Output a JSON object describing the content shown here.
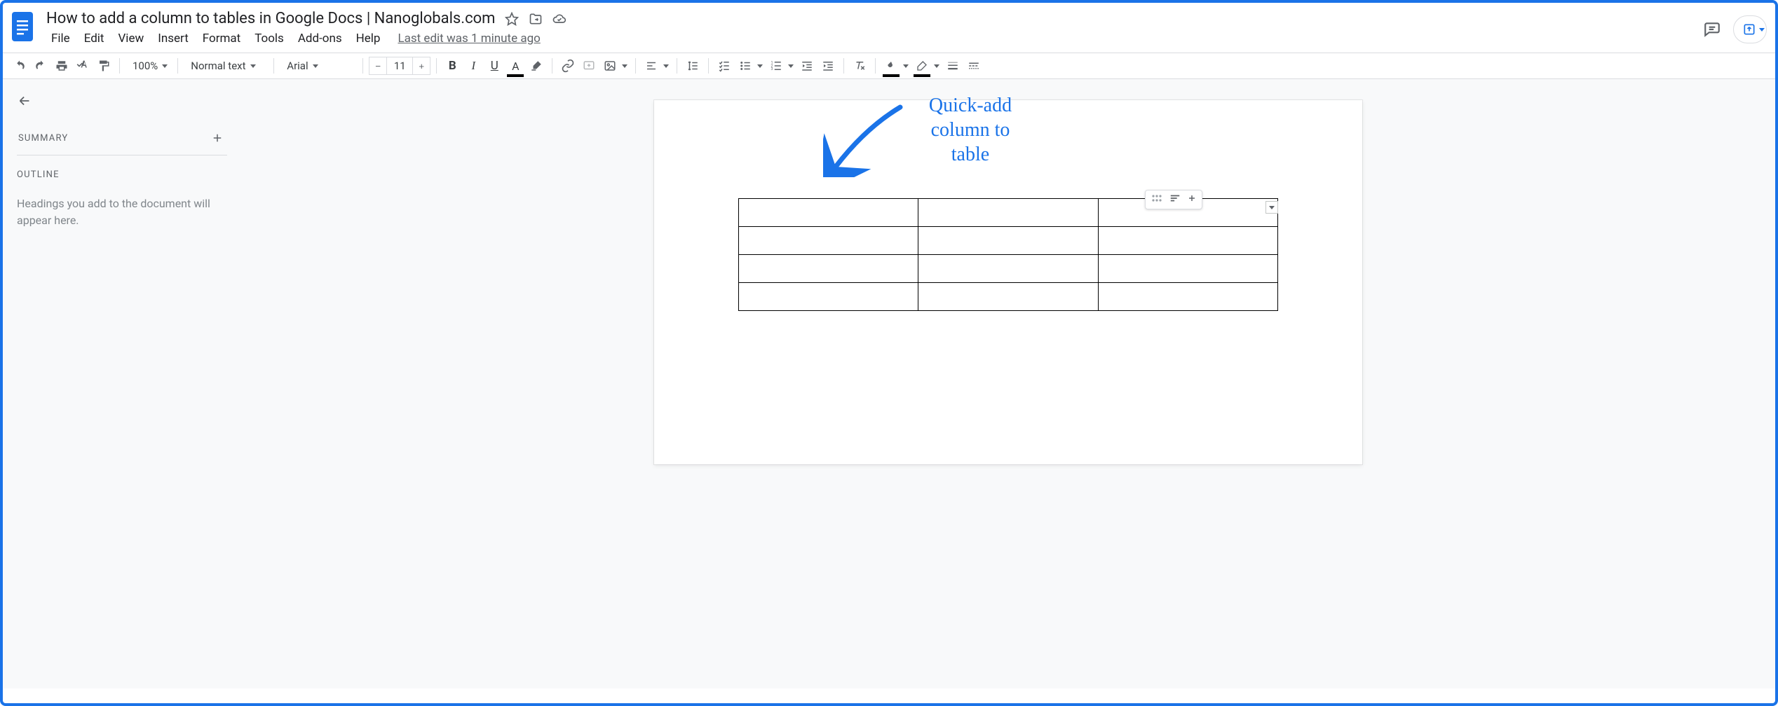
{
  "doc": {
    "title": "How to add a column to tables in Google Docs | Nanoglobals.com",
    "last_edit": "Last edit was 1 minute ago"
  },
  "menus": [
    "File",
    "Edit",
    "View",
    "Insert",
    "Format",
    "Tools",
    "Add-ons",
    "Help"
  ],
  "toolbar": {
    "zoom": "100%",
    "style": "Normal text",
    "font": "Arial",
    "font_size": "11"
  },
  "sidebar": {
    "summary_label": "SUMMARY",
    "outline_label": "OUTLINE",
    "outline_empty": "Headings you add to the document will appear here."
  },
  "table": {
    "rows": 4,
    "cols": 3
  },
  "annotation": {
    "line1": "Quick-add",
    "line2": "column to",
    "line3": "table"
  }
}
